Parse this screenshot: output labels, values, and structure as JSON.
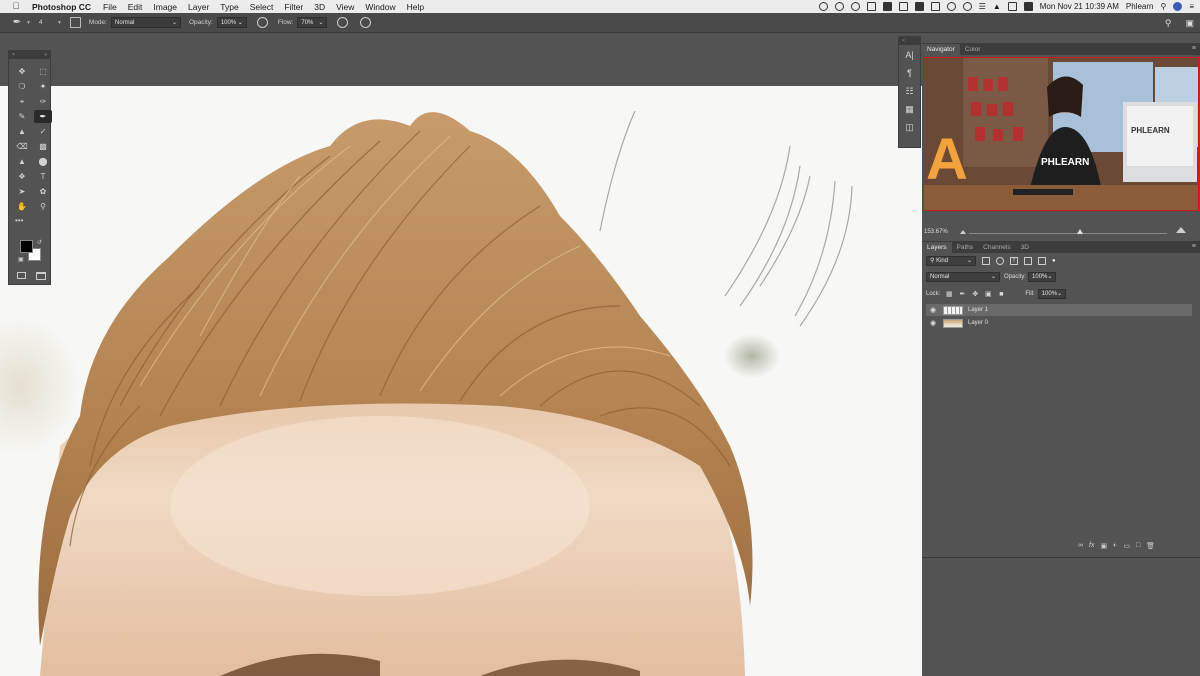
{
  "menubar": {
    "app_name": "Photoshop CC",
    "items": [
      "File",
      "Edit",
      "Image",
      "Layer",
      "Type",
      "Select",
      "Filter",
      "3D",
      "View",
      "Window",
      "Help"
    ],
    "clock": "Mon Nov 21  10:39 AM",
    "user": "Phlearn"
  },
  "options": {
    "brush_size": "4",
    "mode_label": "Mode:",
    "mode_value": "Normal",
    "opacity_label": "Opacity:",
    "opacity_value": "100%",
    "flow_label": "Flow:",
    "flow_value": "70%"
  },
  "tools": {
    "items": [
      "move",
      "marquee",
      "lasso",
      "magic-wand",
      "crop",
      "eyedropper",
      "healing",
      "brush",
      "clone-stamp",
      "history-brush",
      "eraser",
      "gradient",
      "blur",
      "dodge",
      "pen",
      "type",
      "path-select",
      "shape",
      "hand",
      "zoom"
    ],
    "active": "brush"
  },
  "navigator": {
    "tabs": [
      "Navigator",
      "Color"
    ],
    "zoom": "153.67%",
    "zoom_fraction": 0.56
  },
  "layers_panel": {
    "tabs": [
      "Layers",
      "Paths",
      "Channels",
      "3D"
    ],
    "filter_kind": "Kind",
    "blend_mode": "Normal",
    "opacity_label": "Opacity:",
    "opacity_value": "100%",
    "lock_label": "Lock:",
    "fill_label": "Fill:",
    "fill_value": "100%",
    "layers": [
      {
        "name": "Layer 1",
        "visible": true,
        "selected": true
      },
      {
        "name": "Layer 0",
        "visible": true,
        "selected": false
      }
    ]
  },
  "colors": {
    "ui_bg": "#535353",
    "panel_dark": "#3c3c3c",
    "hair": "#b88a5a",
    "skin": "#e8c9a9"
  }
}
